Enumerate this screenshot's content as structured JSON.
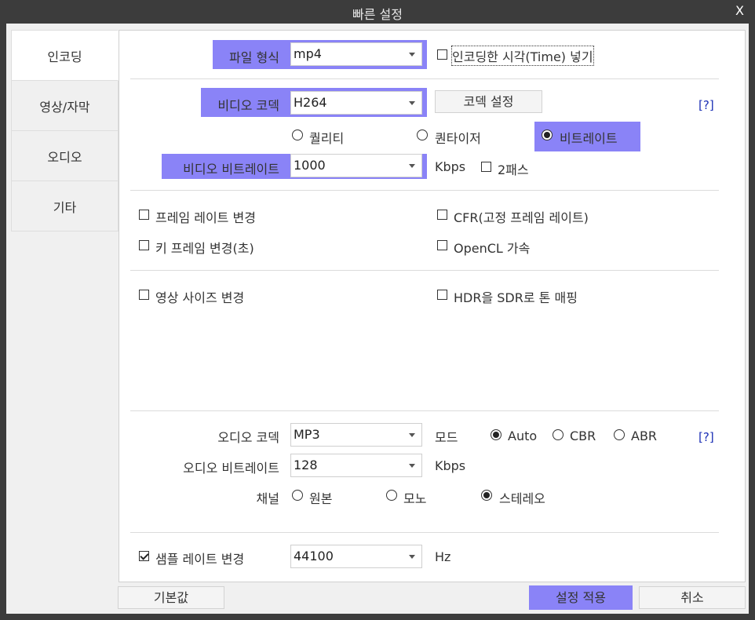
{
  "window": {
    "title": "빠른 설정",
    "close_label": "X"
  },
  "sidebar": {
    "items": [
      {
        "label": "인코딩"
      },
      {
        "label": "영상/자막"
      },
      {
        "label": "오디오"
      },
      {
        "label": "기타"
      }
    ]
  },
  "format": {
    "label": "파일 형식",
    "value": "mp4",
    "insert_time_label": "인코딩한 시각(Time) 넣기"
  },
  "video": {
    "codec_label": "비디오 코덱",
    "codec_value": "H264",
    "codec_settings_label": "코덱 설정",
    "help_label": "[?]",
    "modes": [
      {
        "label": "퀄리티"
      },
      {
        "label": "퀀타이저"
      },
      {
        "label": "비트레이트"
      }
    ],
    "bitrate_label": "비디오 비트레이트",
    "bitrate_value": "1000",
    "bitrate_unit": "Kbps",
    "two_pass_label": "2패스"
  },
  "options": {
    "framerate_change": "프레임 레이트 변경",
    "cfr": "CFR(고정 프레임 레이트)",
    "keyframe_change": "키 프레임 변경(초)",
    "opencl": "OpenCL 가속",
    "resize": "영상 사이즈 변경",
    "hdr_to_sdr": "HDR을 SDR로 톤 매핑"
  },
  "audio": {
    "codec_label": "오디오 코덱",
    "codec_value": "MP3",
    "mode_label": "모드",
    "modes": [
      {
        "label": "Auto"
      },
      {
        "label": "CBR"
      },
      {
        "label": "ABR"
      }
    ],
    "help_label": "[?]",
    "bitrate_label": "오디오 비트레이트",
    "bitrate_value": "128",
    "bitrate_unit": "Kbps",
    "channel_label": "채널",
    "channels": [
      {
        "label": "원본"
      },
      {
        "label": "모노"
      },
      {
        "label": "스테레오"
      }
    ],
    "samplerate_label": "샘플 레이트 변경",
    "samplerate_value": "44100",
    "samplerate_unit": "Hz"
  },
  "footer": {
    "defaults_label": "기본값",
    "apply_label": "설정 적용",
    "cancel_label": "취소"
  },
  "colors": {
    "highlight": "#8a83f7",
    "help_link": "#1b2fb5",
    "title_bar": "#3c3c3c"
  }
}
